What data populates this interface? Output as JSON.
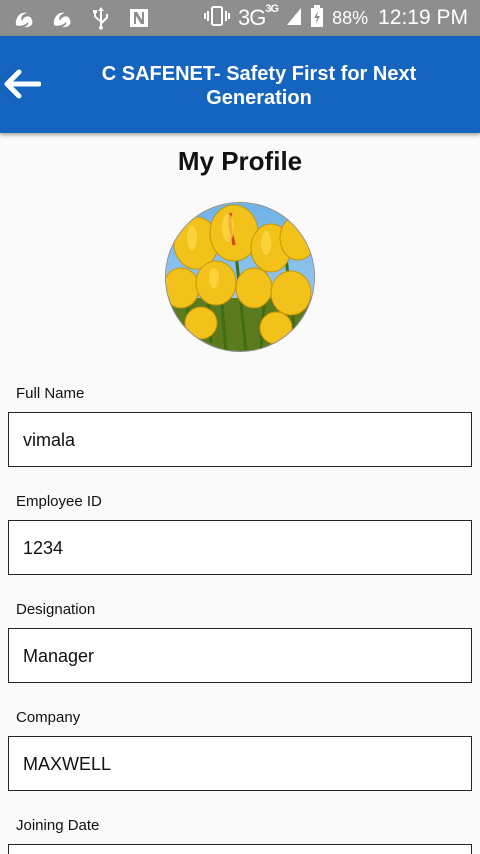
{
  "status_bar": {
    "network": "3G",
    "network_sup": "3G",
    "battery_percent": "88%",
    "time": "12:19 PM"
  },
  "app_bar": {
    "title": "C SAFENET- Safety First for Next Generation"
  },
  "page": {
    "title": "My Profile"
  },
  "fields": [
    {
      "label": "Full Name",
      "value": "vimala"
    },
    {
      "label": "Employee ID",
      "value": "1234"
    },
    {
      "label": "Designation",
      "value": "Manager"
    },
    {
      "label": "Company",
      "value": "MAXWELL"
    },
    {
      "label": "Joining Date",
      "value": ""
    }
  ]
}
